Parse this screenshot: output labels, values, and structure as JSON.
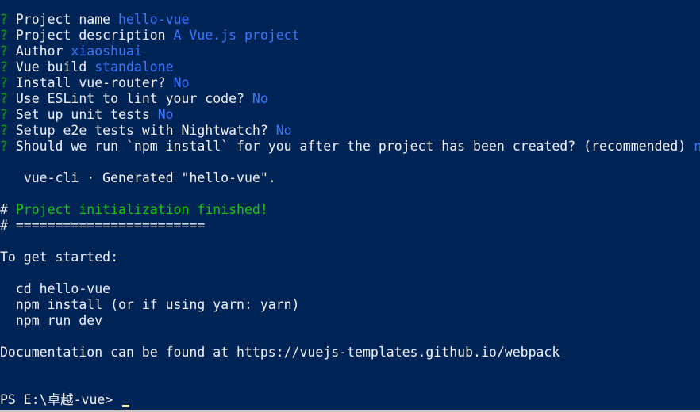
{
  "prompts": [
    {
      "q": "?",
      "label": "Project name",
      "answer": "hello-vue"
    },
    {
      "q": "?",
      "label": "Project description",
      "answer": "A Vue.js project"
    },
    {
      "q": "?",
      "label": "Author",
      "answer": "xiaoshuai"
    },
    {
      "q": "?",
      "label": "Vue build",
      "answer": "standalone"
    },
    {
      "q": "?",
      "label": "Install vue-router?",
      "answer": "No"
    },
    {
      "q": "?",
      "label": "Use ESLint to lint your code?",
      "answer": "No"
    },
    {
      "q": "?",
      "label": "Set up unit tests",
      "answer": "No"
    },
    {
      "q": "?",
      "label": "Setup e2e tests with Nightwatch?",
      "answer": "No"
    },
    {
      "q": "?",
      "label": "Should we run `npm install` for you after the project has been created? (recommended)",
      "answer": "no"
    }
  ],
  "generated": {
    "tool": "vue-cli",
    "dot": "·",
    "message": "Generated \"hello-vue\"."
  },
  "init": {
    "hash1": "#",
    "finished": "Project initialization finished!",
    "hash2": "#",
    "rule": "========================"
  },
  "started": {
    "heading": "To get started:",
    "cmd1": "cd hello-vue",
    "cmd2": "npm install (or if using yarn: yarn)",
    "cmd3": "npm run dev"
  },
  "docs": "Documentation can be found at https://vuejs-templates.github.io/webpack",
  "prompt_line": "PS E:\\卓越-vue> ",
  "colors": {
    "background": "#012456",
    "question_mark": "#13a10e",
    "answer": "#3b78ff",
    "success": "#16c60c",
    "text": "#eeedf0",
    "cursor": "#f9f1a5"
  }
}
